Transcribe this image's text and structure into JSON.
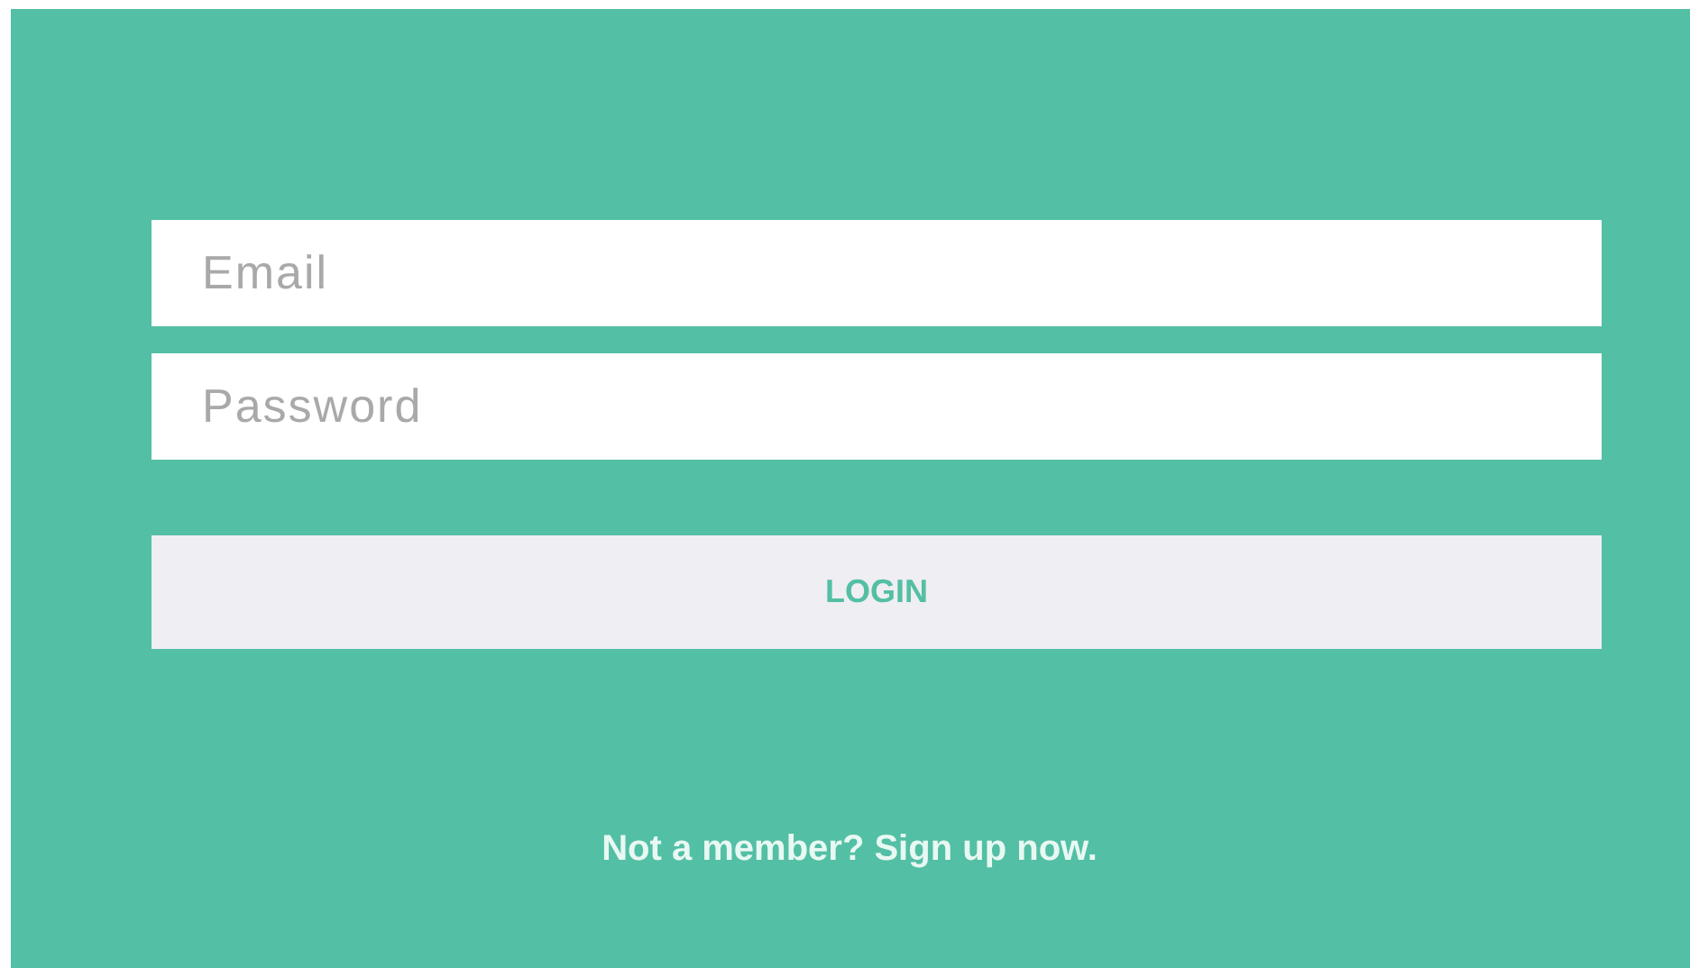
{
  "form": {
    "fields": [
      {
        "placeholder": "Email"
      },
      {
        "placeholder": "Password"
      }
    ],
    "login_button": "LOGIN",
    "signup_link": "Not a member? Sign up now."
  }
}
